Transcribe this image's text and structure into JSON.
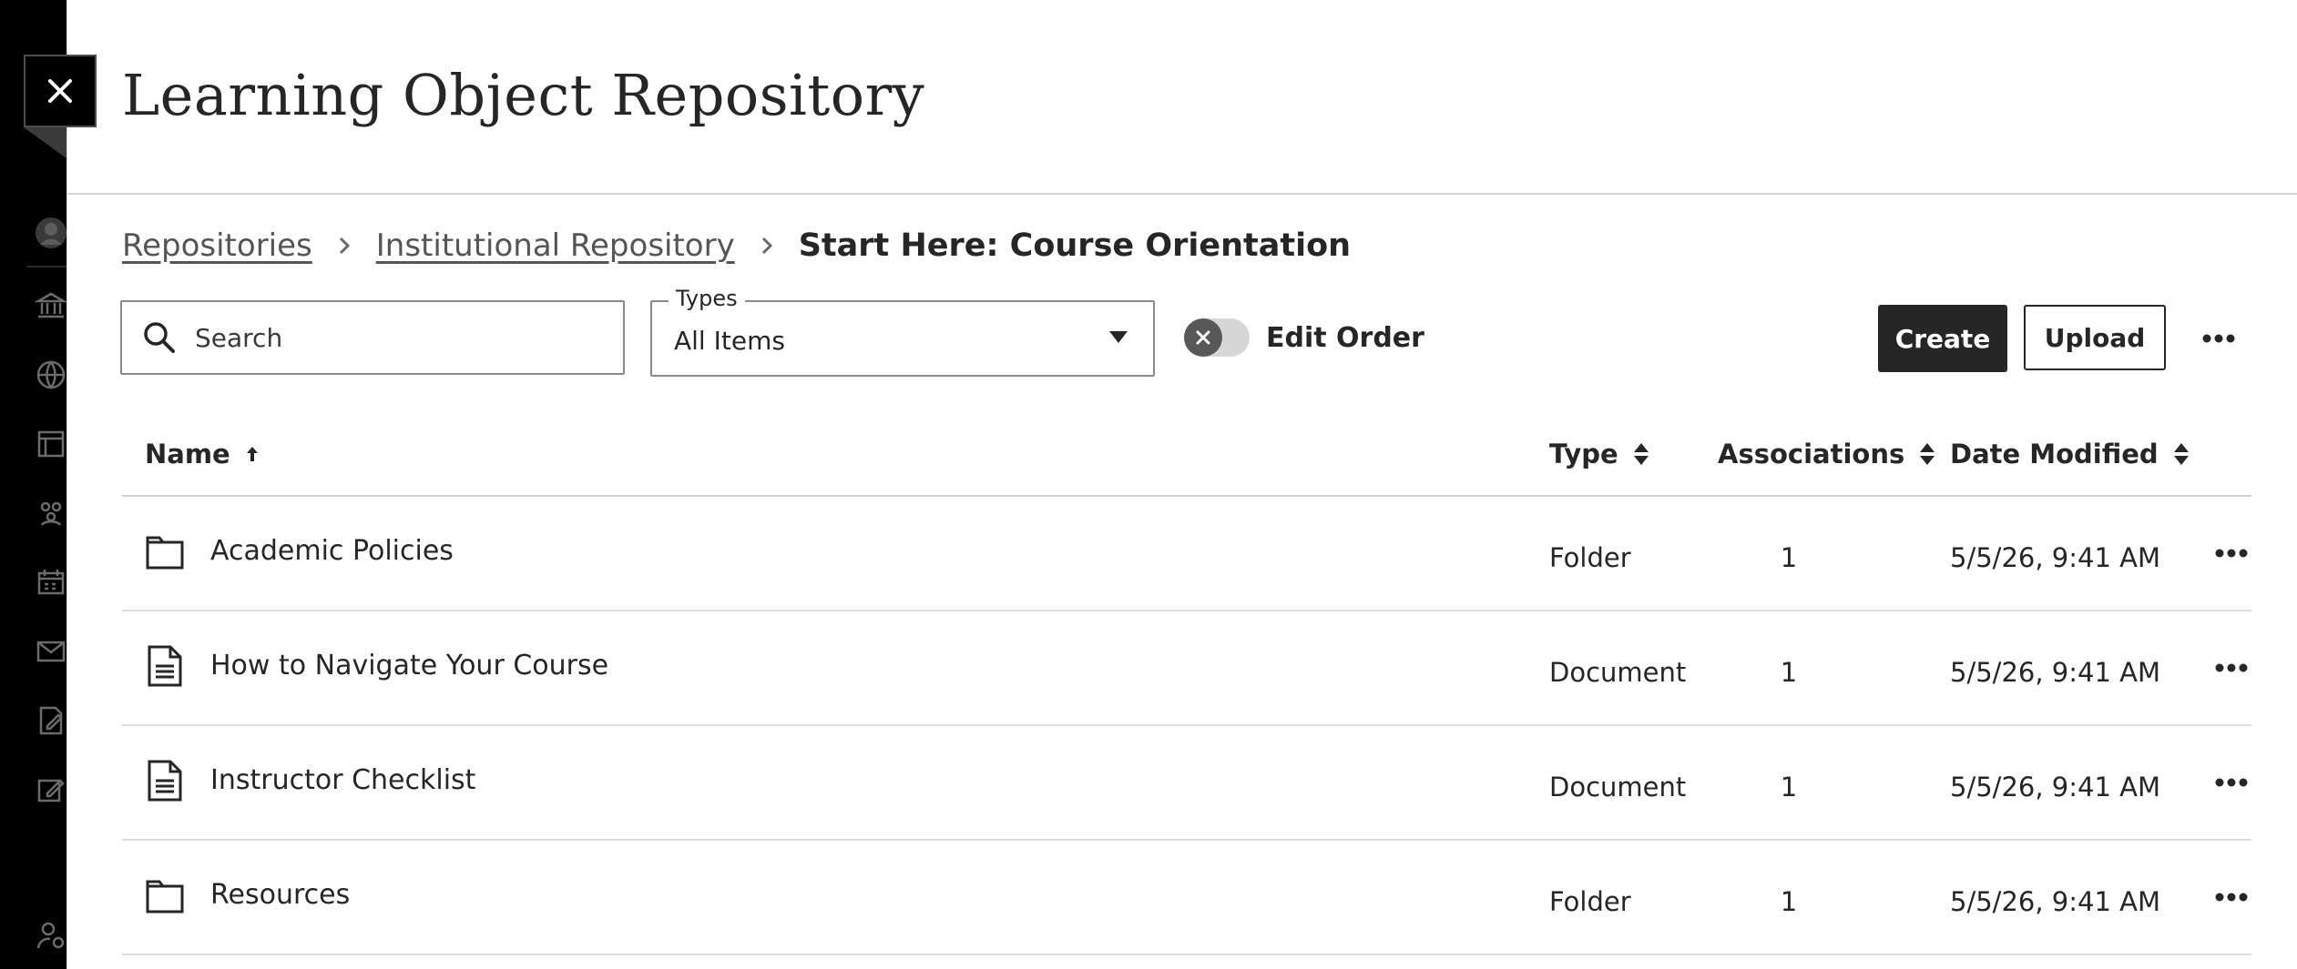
{
  "page": {
    "title": "Learning Object Repository"
  },
  "breadcrumb": [
    {
      "label": "Repositories"
    },
    {
      "label": "Institutional Repository"
    },
    {
      "label": "Start Here: Course Orientation"
    }
  ],
  "toolbar": {
    "search_placeholder": "Search",
    "types_label": "Types",
    "types_value": "All Items",
    "edit_order_label": "Edit Order",
    "edit_order_on": false,
    "create_label": "Create",
    "upload_label": "Upload"
  },
  "table": {
    "columns": [
      "Name",
      "Type",
      "Associations",
      "Date Modified"
    ],
    "sort": {
      "column": "Name",
      "direction": "ascending"
    },
    "rows": [
      {
        "name": "Academic Policies",
        "type": "Folder",
        "icon": "folder-icon",
        "associations": "1",
        "date": "5/5/26, 9:41 AM"
      },
      {
        "name": "How to Navigate Your Course",
        "type": "Document",
        "icon": "document-icon",
        "associations": "1",
        "date": "5/5/26, 9:41 AM"
      },
      {
        "name": "Instructor Checklist",
        "type": "Document",
        "icon": "document-icon",
        "associations": "1",
        "date": "5/5/26, 9:41 AM"
      },
      {
        "name": "Resources",
        "type": "Folder",
        "icon": "folder-icon",
        "associations": "1",
        "date": "5/5/26, 9:41 AM"
      }
    ]
  },
  "sidebar": {
    "icons": [
      "avatar-icon",
      "institution-icon",
      "globe-icon",
      "courses-icon",
      "organizations-icon",
      "calendar-icon",
      "messages-icon",
      "grades-icon",
      "tools-icon",
      "admin-user-icon"
    ]
  },
  "colors": {
    "nav_background": "#000000",
    "primary_button": "#262626",
    "text": "#262626",
    "link": "#555555"
  }
}
